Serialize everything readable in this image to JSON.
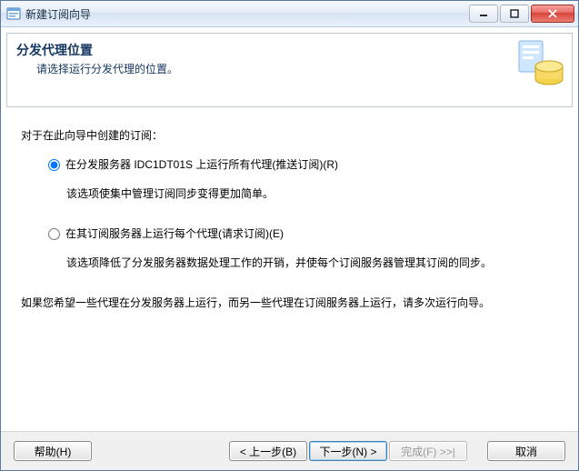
{
  "titlebar": {
    "title": "新建订阅向导"
  },
  "header": {
    "title": "分发代理位置",
    "subtitle": "请选择运行分发代理的位置。"
  },
  "body": {
    "intro": "对于在此向导中创建的订阅：",
    "option1_label": "在分发服务器 IDC1DT01S 上运行所有代理(推送订阅)(R)",
    "option1_desc": "该选项使集中管理订阅同步变得更加简单。",
    "option2_label": "在其订阅服务器上运行每个代理(请求订阅)(E)",
    "option2_desc": "该选项降低了分发服务器数据处理工作的开销，并使每个订阅服务器管理其订阅的同步。",
    "note": "如果您希望一些代理在分发服务器上运行，而另一些代理在订阅服务器上运行，请多次运行向导。"
  },
  "footer": {
    "help": "帮助(H)",
    "back": "< 上一步(B)",
    "next": "下一步(N) >",
    "finish": "完成(F) >>|",
    "cancel": "取消"
  }
}
